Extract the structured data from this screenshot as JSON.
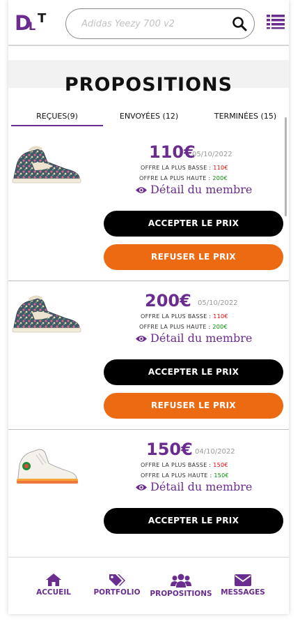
{
  "header": {
    "logo_part1": "D",
    "logo_part2": "L",
    "logo_part3": "T",
    "search_placeholder": "Adidas Yeezy 700 v2",
    "search_icon": "search-icon",
    "menu_icon": "list-menu-icon"
  },
  "page_title": "PROPOSITIONS",
  "tabs": [
    {
      "label": "REÇUES(9)",
      "active": true
    },
    {
      "label": "ENVOYÉES (12)",
      "active": false
    },
    {
      "label": "TERMINÉES (15)",
      "active": false
    }
  ],
  "offers": [
    {
      "price": "110€",
      "date": "05/10/2022",
      "lowest_label": "OFFRE LA PLUS BASSE : ",
      "lowest_value": "110€",
      "highest_label": "OFFRE LA PLUS HAUTE : ",
      "highest_value": "200€",
      "member_link": "Détail du membre",
      "accept_label": "ACCEPTER LE PRIX",
      "refuse_label": "REFUSER LE PRIX",
      "image": "floral-high-top-sneaker"
    },
    {
      "price": "200€",
      "date": "05/10/2022",
      "lowest_label": "OFFRE LA PLUS BASSE : ",
      "lowest_value": "110€",
      "highest_label": "OFFRE LA PLUS HAUTE : ",
      "highest_value": "200€",
      "member_link": "Détail du membre",
      "accept_label": "ACCEPTER LE PRIX",
      "refuse_label": "REFUSER LE PRIX",
      "image": "floral-high-top-sneaker"
    },
    {
      "price": "150€",
      "date": "04/10/2022",
      "lowest_label": "OFFRE LA PLUS BASSE : ",
      "lowest_value": "150€",
      "highest_label": "OFFRE LA PLUS HAUTE : ",
      "highest_value": "150€",
      "member_link": "Détail du membre",
      "accept_label": "ACCEPTER LE PRIX",
      "image": "white-high-top-sneaker"
    }
  ],
  "bottom_nav": [
    {
      "label": "ACCUEIL",
      "icon": "home-icon"
    },
    {
      "label": "PORTFOLIO",
      "icon": "tags-icon"
    },
    {
      "label": "PROPOSITIONS",
      "icon": "users-icon"
    },
    {
      "label": "MESSAGES",
      "icon": "envelope-icon"
    }
  ],
  "colors": {
    "brand_purple": "#6a2c8f",
    "accept_button": "#000000",
    "refuse_button": "#ec6b12",
    "low_offer": "#e00000",
    "high_offer": "#008a00"
  }
}
